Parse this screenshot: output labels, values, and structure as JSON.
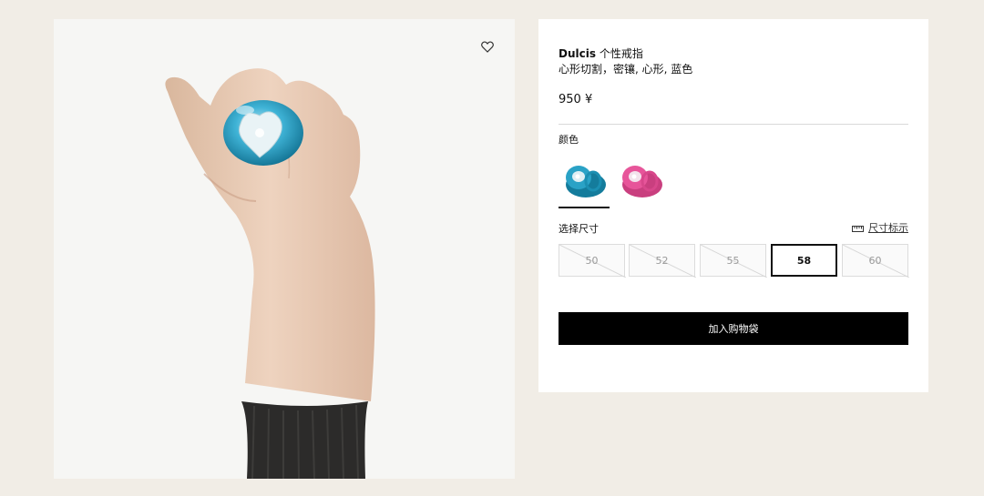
{
  "product": {
    "brand": "Dulcis",
    "name": "个性戒指",
    "subtitle": "心形切割，密镶, 心形, 蓝色",
    "price": "950 ¥"
  },
  "color": {
    "label": "颜色",
    "options": [
      {
        "name": "蓝色",
        "hex": "#2aa2c6",
        "selected": true
      },
      {
        "name": "粉色",
        "hex": "#e7559a",
        "selected": false
      }
    ]
  },
  "size": {
    "label": "选择尺寸",
    "guide_label": "尺寸标示",
    "options": [
      {
        "value": "50",
        "available": false,
        "selected": false
      },
      {
        "value": "52",
        "available": false,
        "selected": false
      },
      {
        "value": "55",
        "available": false,
        "selected": false
      },
      {
        "value": "58",
        "available": true,
        "selected": true
      },
      {
        "value": "60",
        "available": false,
        "selected": false
      }
    ]
  },
  "actions": {
    "add_to_bag": "加入购物袋"
  }
}
